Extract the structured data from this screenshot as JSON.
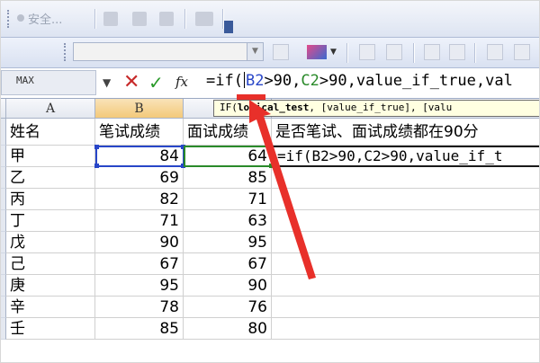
{
  "toolbar1": {
    "safety_label": "安全..."
  },
  "namebox": {
    "value": "MAX",
    "dropdown": "▼"
  },
  "formula_bar": {
    "cancel_glyph": "✕",
    "enter_glyph": "✓",
    "fx_label": "fx",
    "formula_pre": "=if(",
    "ref_b2": "B2",
    "mid1": ">90,",
    "ref_c2": "C2",
    "mid2": ">90,value_if_true,val"
  },
  "tooltip": {
    "prefix": "IF(",
    "bold_arg": "logical_test",
    "rest": ", [value_if_true], [valu"
  },
  "columns": [
    "A",
    "B",
    "C"
  ],
  "headers": [
    "姓名",
    "笔试成绩",
    "面试成绩",
    "是否笔试、面试成绩都在90分"
  ],
  "d2_text": "=if(B2>90,C2>90,value_if_t",
  "rows": [
    {
      "name": "甲",
      "written": "84",
      "interview": "64"
    },
    {
      "name": "乙",
      "written": "69",
      "interview": "85"
    },
    {
      "name": "丙",
      "written": "82",
      "interview": "71"
    },
    {
      "name": "丁",
      "written": "71",
      "interview": "63"
    },
    {
      "name": "戊",
      "written": "90",
      "interview": "95"
    },
    {
      "name": "己",
      "written": "67",
      "interview": "67"
    },
    {
      "name": "庚",
      "written": "95",
      "interview": "90"
    },
    {
      "name": "辛",
      "written": "78",
      "interview": "76"
    },
    {
      "name": "壬",
      "written": "85",
      "interview": "80"
    }
  ],
  "colors": {
    "b2_ref": "#2846c8",
    "c2_ref": "#2a8a2a",
    "arrow": "#e8302a"
  }
}
